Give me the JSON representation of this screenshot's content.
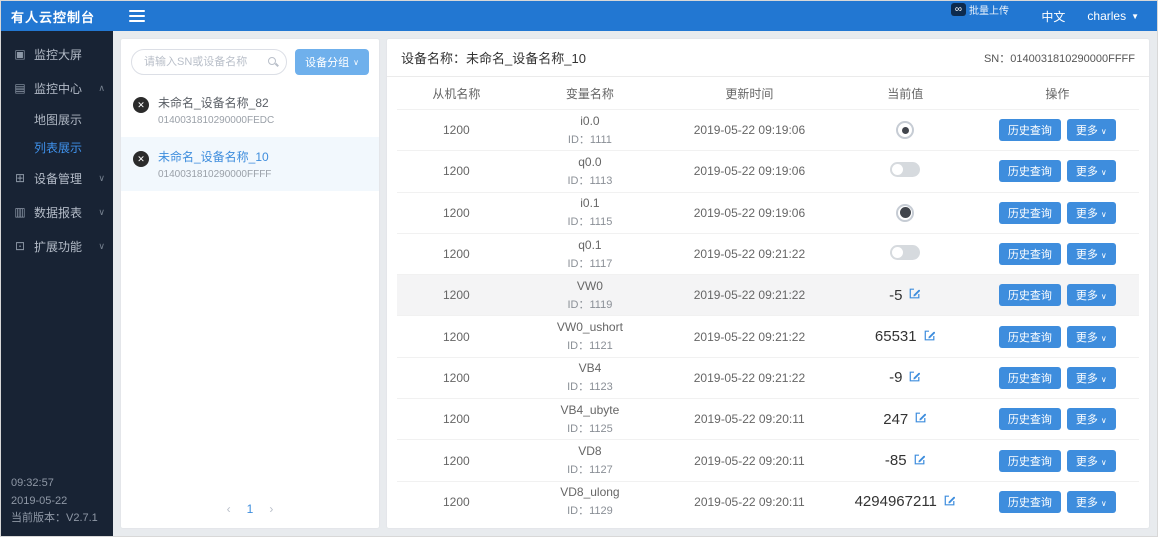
{
  "colors": {
    "accent": "#3e8ddd",
    "header_bg": "#2277d2",
    "sidebar_bg": "#182334"
  },
  "header": {
    "app_title": "有人云控制台",
    "upload_badge_icon": "∞",
    "upload_badge": "批量上传",
    "lang": "中文",
    "user": "charles"
  },
  "sidebar": {
    "items": [
      {
        "label": "监控大屏"
      },
      {
        "label": "监控中心"
      },
      {
        "label": "地图展示"
      },
      {
        "label": "列表展示"
      },
      {
        "label": "设备管理"
      },
      {
        "label": "数据报表"
      },
      {
        "label": "扩展功能"
      }
    ],
    "clock_time": "09:32:57",
    "clock_date": "2019-05-22",
    "version": "当前版本：V2.7.1"
  },
  "device_panel": {
    "search_placeholder": "请输入SN或设备名称",
    "group_button": "设备分组",
    "devices": [
      {
        "name": "未命名_设备名称_82",
        "sn": "0140031810290000FEDC",
        "active": false
      },
      {
        "name": "未命名_设备名称_10",
        "sn": "0140031810290000FFFF",
        "active": true
      }
    ],
    "page": "1",
    "prev": "‹",
    "next": "›"
  },
  "detail_panel": {
    "title": "设备名称：未命名_设备名称_10",
    "sn_label": "SN：0140031810290000FFFF",
    "table": {
      "headers": [
        "从机名称",
        "变量名称",
        "更新时间",
        "当前值",
        "操作"
      ],
      "history_label": "历史查询",
      "more_label": "更多",
      "rows": [
        {
          "slave": "1200",
          "var": "i0.0",
          "id": "ID：1111",
          "time": "2019-05-22 09:19:06",
          "value_type": "radio-small",
          "value": "",
          "highlight": false
        },
        {
          "slave": "1200",
          "var": "q0.0",
          "id": "ID：1113",
          "time": "2019-05-22 09:19:06",
          "value_type": "toggle-off",
          "value": "",
          "highlight": false
        },
        {
          "slave": "1200",
          "var": "i0.1",
          "id": "ID：1115",
          "time": "2019-05-22 09:19:06",
          "value_type": "radio-large",
          "value": "",
          "highlight": false
        },
        {
          "slave": "1200",
          "var": "q0.1",
          "id": "ID：1117",
          "time": "2019-05-22 09:21:22",
          "value_type": "toggle-off",
          "value": "",
          "highlight": false
        },
        {
          "slave": "1200",
          "var": "VW0",
          "id": "ID：1119",
          "time": "2019-05-22 09:21:22",
          "value_type": "number",
          "value": "-5",
          "highlight": true
        },
        {
          "slave": "1200",
          "var": "VW0_ushort",
          "id": "ID：1121",
          "time": "2019-05-22 09:21:22",
          "value_type": "number",
          "value": "65531",
          "highlight": false
        },
        {
          "slave": "1200",
          "var": "VB4",
          "id": "ID：1123",
          "time": "2019-05-22 09:21:22",
          "value_type": "number",
          "value": "-9",
          "highlight": false
        },
        {
          "slave": "1200",
          "var": "VB4_ubyte",
          "id": "ID：1125",
          "time": "2019-05-22 09:20:11",
          "value_type": "number",
          "value": "247",
          "highlight": false
        },
        {
          "slave": "1200",
          "var": "VD8",
          "id": "ID：1127",
          "time": "2019-05-22 09:20:11",
          "value_type": "number",
          "value": "-85",
          "highlight": false
        },
        {
          "slave": "1200",
          "var": "VD8_ulong",
          "id": "ID：1129",
          "time": "2019-05-22 09:20:11",
          "value_type": "number",
          "value": "4294967211",
          "highlight": false
        }
      ]
    }
  }
}
